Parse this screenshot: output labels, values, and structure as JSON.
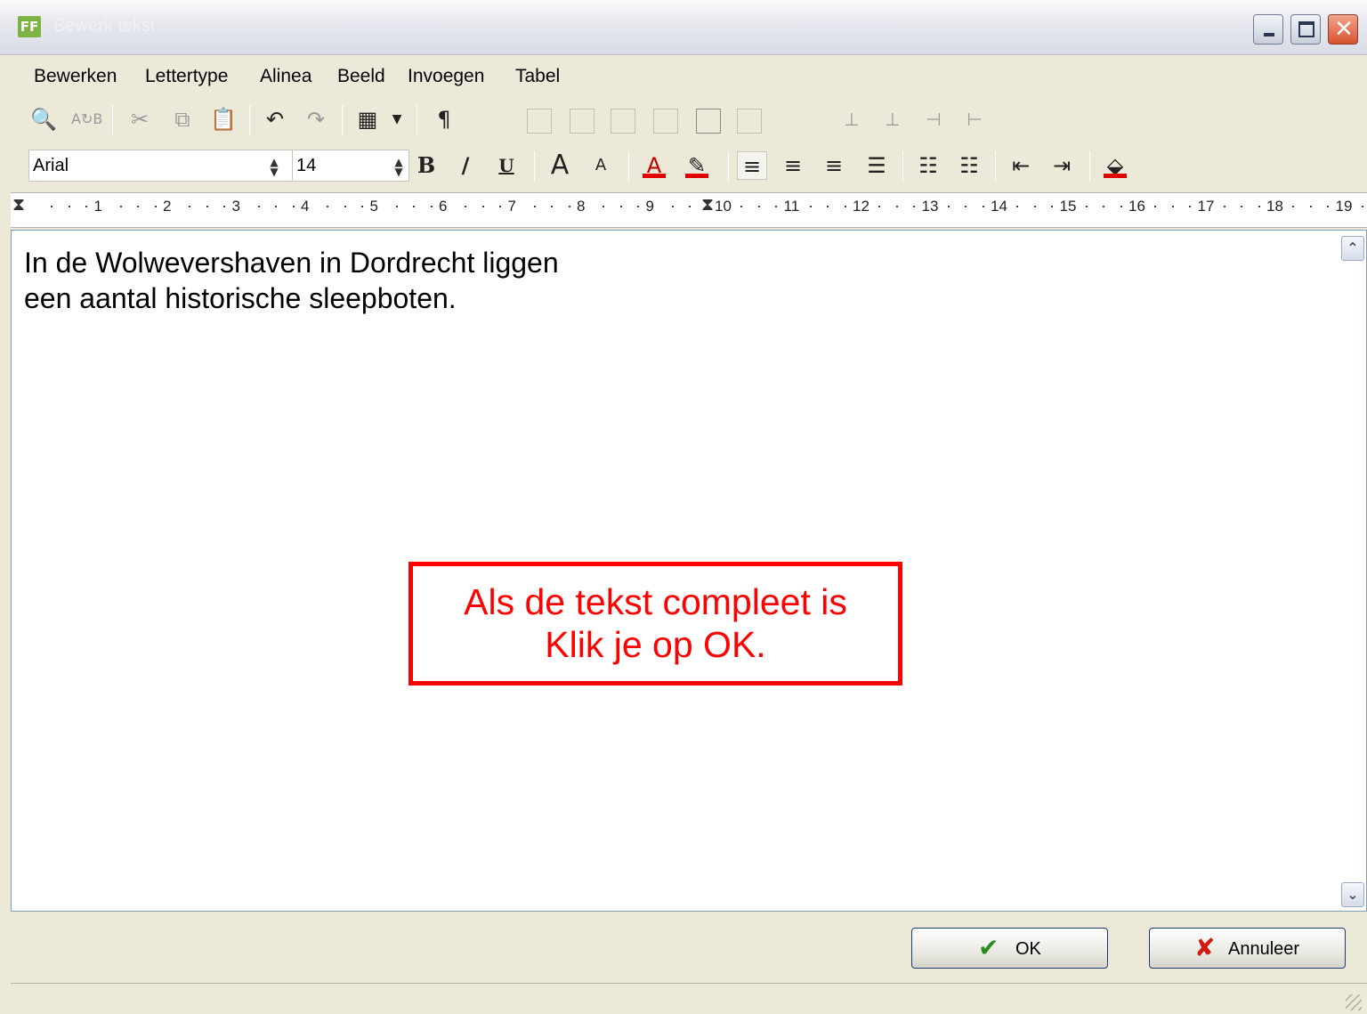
{
  "window": {
    "title": "Bewerk tekst",
    "app_icon": "FF"
  },
  "menu": [
    "Bewerken",
    "Lettertype",
    "Alinea",
    "Beeld",
    "Invoegen",
    "Tabel"
  ],
  "font": {
    "name": "Arial",
    "size": "14"
  },
  "format_buttons": {
    "bold": "B",
    "italic": "/",
    "underline": "U"
  },
  "ruler": [
    "1",
    "2",
    "3",
    "4",
    "5",
    "6",
    "7",
    "8",
    "9",
    "10",
    "11",
    "12",
    "13",
    "14",
    "15",
    "16",
    "17",
    "18",
    "19"
  ],
  "document": {
    "lines": [
      "In de Wolwevershaven in Dordrecht liggen",
      "een aantal historische sleepboten."
    ]
  },
  "callout": {
    "lines": [
      "Als de tekst compleet is",
      "Klik je op OK."
    ],
    "color": "#ff0000"
  },
  "buttons": {
    "ok": "OK",
    "cancel": "Annuleer"
  },
  "colors": {
    "text_color_bar": "#e00000",
    "ok_check": "#2e8b1f",
    "cancel_x": "#d21a10"
  }
}
